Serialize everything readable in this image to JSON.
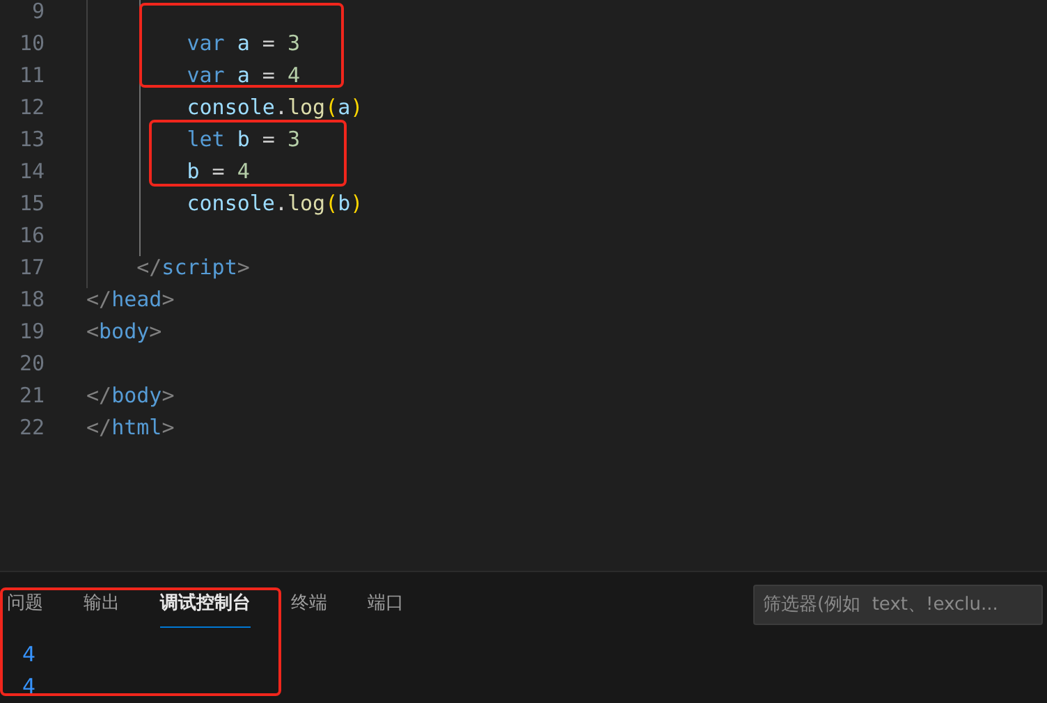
{
  "editor": {
    "lines": [
      {
        "children": [
          {
            "children": [
              {
                "number": "9"
              },
              {
                "number": "10",
                "tokens": [
                  {
                    "kind": "keyword",
                    "text": "var "
                  },
                  {
                    "kind": "variable",
                    "text": "a "
                  },
                  {
                    "kind": "operator",
                    "text": "= "
                  },
                  {
                    "kind": "number",
                    "text": "3"
                  }
                ]
              },
              {
                "number": "11",
                "tokens": [
                  {
                    "kind": "keyword",
                    "text": "var "
                  },
                  {
                    "kind": "variable",
                    "text": "a "
                  },
                  {
                    "kind": "operator",
                    "text": "= "
                  },
                  {
                    "kind": "number",
                    "text": "4"
                  }
                ]
              },
              {
                "number": "12",
                "tokens": [
                  {
                    "kind": "variable",
                    "text": "console"
                  },
                  {
                    "kind": "operator",
                    "text": "."
                  },
                  {
                    "kind": "function",
                    "text": "log"
                  },
                  {
                    "kind": "bracket",
                    "text": "("
                  },
                  {
                    "kind": "variable",
                    "text": "a"
                  },
                  {
                    "kind": "bracket",
                    "text": ")"
                  }
                ]
              },
              {
                "number": "13",
                "tokens": [
                  {
                    "kind": "keyword",
                    "text": "let "
                  },
                  {
                    "kind": "variable",
                    "text": "b "
                  },
                  {
                    "kind": "operator",
                    "text": "= "
                  },
                  {
                    "kind": "number",
                    "text": "3"
                  }
                ]
              },
              {
                "number": "14",
                "tokens": [
                  {
                    "kind": "variable",
                    "text": "b "
                  },
                  {
                    "kind": "operator",
                    "text": "= "
                  },
                  {
                    "kind": "number",
                    "text": "4"
                  }
                ]
              },
              {
                "number": "15",
                "tokens": [
                  {
                    "kind": "variable",
                    "text": "console"
                  },
                  {
                    "kind": "operator",
                    "text": "."
                  },
                  {
                    "kind": "function",
                    "text": "log"
                  },
                  {
                    "kind": "bracket",
                    "text": "("
                  },
                  {
                    "kind": "variable",
                    "text": "b"
                  },
                  {
                    "kind": "bracket",
                    "text": ")"
                  }
                ]
              },
              {
                "number": "16"
              }
            ]
          },
          {
            "number": "17",
            "tokens": [
              {
                "kind": "punct",
                "text": "</"
              },
              {
                "kind": "tag",
                "text": "script"
              },
              {
                "kind": "punct",
                "text": ">"
              }
            ]
          }
        ]
      },
      {
        "number": "18",
        "tokens": [
          {
            "kind": "punct",
            "text": "</"
          },
          {
            "kind": "tag",
            "text": "head"
          },
          {
            "kind": "punct",
            "text": ">"
          }
        ]
      },
      {
        "number": "19",
        "tokens": [
          {
            "kind": "punct",
            "text": "<"
          },
          {
            "kind": "tag",
            "text": "body"
          },
          {
            "kind": "punct",
            "text": ">"
          }
        ]
      },
      {
        "number": "20"
      },
      {
        "number": "21",
        "tokens": [
          {
            "kind": "punct",
            "text": "</"
          },
          {
            "kind": "tag",
            "text": "body"
          },
          {
            "kind": "punct",
            "text": ">"
          }
        ]
      },
      {
        "number": "22",
        "tokens": [
          {
            "kind": "punct",
            "text": "</"
          },
          {
            "kind": "tag",
            "text": "html"
          },
          {
            "kind": "punct",
            "text": ">"
          }
        ]
      }
    ]
  },
  "panel": {
    "tabs": [
      {
        "label": "问题",
        "selected": false
      },
      {
        "label": "输出",
        "selected": false
      },
      {
        "label": "调试控制台",
        "selected": true
      },
      {
        "label": "终端",
        "selected": false
      },
      {
        "label": "端口",
        "selected": false
      }
    ],
    "filter": {
      "placeholder": "筛选器(例如  text、!exclu..."
    },
    "console_output": [
      "4",
      "4"
    ]
  }
}
